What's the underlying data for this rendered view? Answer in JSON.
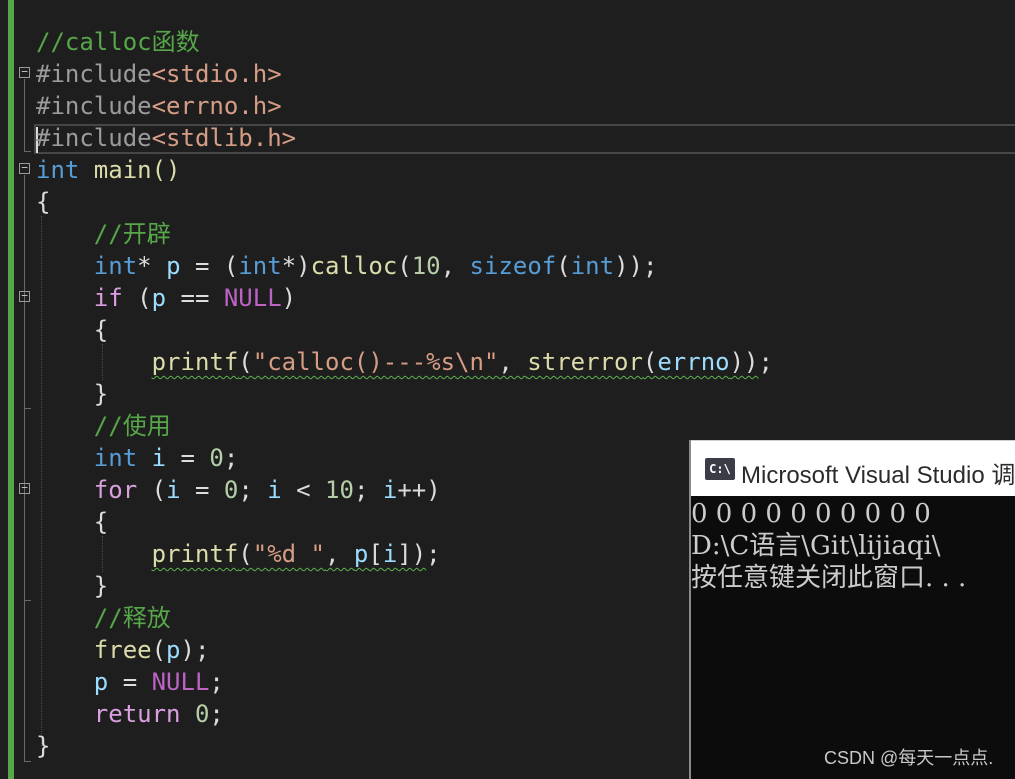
{
  "editor": {
    "lines": [
      {
        "parts": [
          {
            "t": "//calloc函数",
            "c": "cm"
          }
        ]
      },
      {
        "parts": [
          {
            "t": "#include",
            "c": "pp"
          },
          {
            "t": "<stdio.h>",
            "c": "inc"
          }
        ]
      },
      {
        "parts": [
          {
            "t": "#include",
            "c": "pp"
          },
          {
            "t": "<errno.h>",
            "c": "inc"
          }
        ]
      },
      {
        "parts": [
          {
            "t": "#include",
            "c": "pp"
          },
          {
            "t": "<stdlib.h>",
            "c": "inc"
          }
        ]
      },
      {
        "parts": [
          {
            "t": "int",
            "c": "kw"
          },
          {
            "t": " main()",
            "c": "fn"
          }
        ]
      },
      {
        "parts": [
          {
            "t": "{",
            "c": ""
          }
        ]
      },
      {
        "parts": [
          {
            "t": "    "
          },
          {
            "t": "//开辟",
            "c": "cm"
          }
        ]
      },
      {
        "parts": [
          {
            "t": "    "
          },
          {
            "t": "int",
            "c": "kw"
          },
          {
            "t": "* "
          },
          {
            "t": "p",
            "c": "var"
          },
          {
            "t": " = ("
          },
          {
            "t": "int",
            "c": "kw"
          },
          {
            "t": "*)"
          },
          {
            "t": "calloc",
            "c": "fn"
          },
          {
            "t": "("
          },
          {
            "t": "10",
            "c": "num"
          },
          {
            "t": ", "
          },
          {
            "t": "sizeof",
            "c": "kw"
          },
          {
            "t": "("
          },
          {
            "t": "int",
            "c": "kw"
          },
          {
            "t": "));"
          }
        ]
      },
      {
        "parts": [
          {
            "t": "    "
          },
          {
            "t": "if",
            "c": "ctl"
          },
          {
            "t": " ("
          },
          {
            "t": "p",
            "c": "var"
          },
          {
            "t": " == "
          },
          {
            "t": "NULL",
            "c": "mac"
          },
          {
            "t": ")"
          }
        ]
      },
      {
        "parts": [
          {
            "t": "    {"
          }
        ]
      },
      {
        "parts": [
          {
            "t": "        "
          },
          {
            "t": "printf",
            "c": "fn sq"
          },
          {
            "t": "(",
            "c": "sq"
          },
          {
            "t": "\"calloc()---%s\\n\"",
            "c": "str sq"
          },
          {
            "t": ", ",
            "c": "sq"
          },
          {
            "t": "strerror",
            "c": "fn sq"
          },
          {
            "t": "(",
            "c": "sq"
          },
          {
            "t": "errno",
            "c": "var sq"
          },
          {
            "t": "))",
            "c": "sq"
          },
          {
            "t": ";"
          }
        ]
      },
      {
        "parts": [
          {
            "t": "    }"
          }
        ]
      },
      {
        "parts": [
          {
            "t": "    "
          },
          {
            "t": "//使用",
            "c": "cm"
          }
        ]
      },
      {
        "parts": [
          {
            "t": "    "
          },
          {
            "t": "int",
            "c": "kw"
          },
          {
            "t": " "
          },
          {
            "t": "i",
            "c": "var"
          },
          {
            "t": " = "
          },
          {
            "t": "0",
            "c": "num"
          },
          {
            "t": ";"
          }
        ]
      },
      {
        "parts": [
          {
            "t": "    "
          },
          {
            "t": "for",
            "c": "ctl"
          },
          {
            "t": " ("
          },
          {
            "t": "i",
            "c": "var"
          },
          {
            "t": " = "
          },
          {
            "t": "0",
            "c": "num"
          },
          {
            "t": "; "
          },
          {
            "t": "i",
            "c": "var"
          },
          {
            "t": " < "
          },
          {
            "t": "10",
            "c": "num"
          },
          {
            "t": "; "
          },
          {
            "t": "i",
            "c": "var"
          },
          {
            "t": "++)"
          }
        ]
      },
      {
        "parts": [
          {
            "t": "    {"
          }
        ]
      },
      {
        "parts": [
          {
            "t": "        "
          },
          {
            "t": "printf",
            "c": "fn sq"
          },
          {
            "t": "(",
            "c": "sq"
          },
          {
            "t": "\"%d \"",
            "c": "str sq"
          },
          {
            "t": ", ",
            "c": "sq"
          },
          {
            "t": "p",
            "c": "var sq"
          },
          {
            "t": "[",
            "c": "sq"
          },
          {
            "t": "i",
            "c": "var sq"
          },
          {
            "t": "])",
            "c": "sq"
          },
          {
            "t": ";"
          }
        ]
      },
      {
        "parts": [
          {
            "t": "    }"
          }
        ]
      },
      {
        "parts": [
          {
            "t": "    "
          },
          {
            "t": "//释放",
            "c": "cm"
          }
        ]
      },
      {
        "parts": [
          {
            "t": "    "
          },
          {
            "t": "free",
            "c": "fn"
          },
          {
            "t": "("
          },
          {
            "t": "p",
            "c": "var"
          },
          {
            "t": ");"
          }
        ]
      },
      {
        "parts": [
          {
            "t": "    "
          },
          {
            "t": "p",
            "c": "var"
          },
          {
            "t": " = "
          },
          {
            "t": "NULL",
            "c": "mac"
          },
          {
            "t": ";"
          }
        ]
      },
      {
        "parts": [
          {
            "t": "    "
          },
          {
            "t": "return",
            "c": "ctl"
          },
          {
            "t": " "
          },
          {
            "t": "0",
            "c": "num"
          },
          {
            "t": ";"
          }
        ]
      },
      {
        "parts": [
          {
            "t": "}"
          }
        ]
      }
    ],
    "fold_glyph": "−"
  },
  "console": {
    "icon_label": "C:\\",
    "title": "Microsoft Visual Studio 调试控制台",
    "output": [
      "0 0 0 0 0 0 0 0 0 0",
      "D:\\C语言\\Git\\lijiaqi\\",
      "按任意键关闭此窗口. . ."
    ]
  },
  "watermark": "CSDN @每天一点点."
}
